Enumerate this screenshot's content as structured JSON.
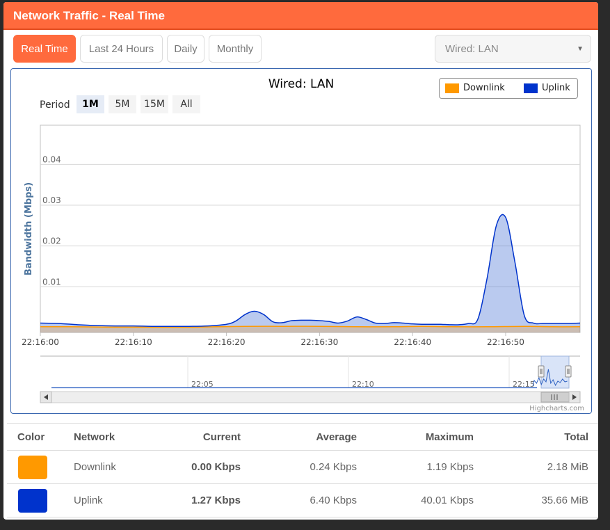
{
  "panel": {
    "title": "Network Traffic - Real Time"
  },
  "tabs": [
    {
      "label": "Real Time",
      "active": true
    },
    {
      "label": "Last 24 Hours",
      "active": false
    },
    {
      "label": "Daily",
      "active": false
    },
    {
      "label": "Monthly",
      "active": false
    }
  ],
  "network_select": {
    "value": "Wired: LAN"
  },
  "chart": {
    "title": "Wired: LAN",
    "period_label": "Period",
    "range_buttons": [
      {
        "label": "1M",
        "active": true
      },
      {
        "label": "5M",
        "active": false
      },
      {
        "label": "15M",
        "active": false
      },
      {
        "label": "All",
        "active": false
      }
    ],
    "legend": [
      {
        "name": "Downlink",
        "color": "#ff9900"
      },
      {
        "name": "Uplink",
        "color": "#0033cc"
      }
    ],
    "credits": "Highcharts.com",
    "navigator_labels": [
      "22:05",
      "22:10",
      "22:15"
    ]
  },
  "chart_data": {
    "type": "area",
    "ylabel": "Bandwidth (Mbps)",
    "xlabel": "",
    "y_ticks": [
      "0.01",
      "0.02",
      "0.03",
      "0.04"
    ],
    "x_ticks": [
      "22:16:00",
      "22:16:10",
      "22:16:20",
      "22:16:30",
      "22:16:40",
      "22:16:50"
    ],
    "ylim": [
      -0.0012,
      0.0496
    ],
    "xlim_seconds": [
      0,
      58
    ],
    "x_unit": "seconds after 22:16:00",
    "grid": true,
    "legend_position": "top-right",
    "series": [
      {
        "name": "Downlink",
        "color": "#ff9900",
        "x": [
          0,
          3,
          8,
          12,
          16,
          19,
          22,
          26,
          30,
          34,
          38,
          41,
          44,
          48,
          52,
          55,
          58
        ],
        "y": [
          0.0002,
          0.0002,
          0.0001,
          0.0001,
          0.0001,
          0.0002,
          0.0003,
          0.0003,
          0.0003,
          0.0002,
          0.0002,
          0.0003,
          0.0002,
          0.0002,
          0.0003,
          0.0002,
          0.0002
        ]
      },
      {
        "name": "Uplink",
        "color": "#0033cc",
        "x": [
          0,
          2,
          4,
          6,
          8,
          10,
          12,
          14,
          16,
          18,
          20,
          21,
          22,
          23,
          24,
          25,
          26,
          27,
          28,
          29,
          30,
          31,
          32,
          33,
          34,
          35,
          36,
          37,
          38,
          39,
          40,
          41,
          42,
          43,
          44,
          45,
          46,
          47,
          48,
          49,
          50,
          51,
          52,
          53,
          54,
          55,
          56,
          57,
          58
        ],
        "y": [
          0.0011,
          0.001,
          0.0007,
          0.0005,
          0.0004,
          0.0004,
          0.0003,
          0.0003,
          0.0003,
          0.0004,
          0.0008,
          0.0016,
          0.0032,
          0.004,
          0.0032,
          0.0014,
          0.0012,
          0.0017,
          0.0018,
          0.0018,
          0.0017,
          0.0015,
          0.0011,
          0.0016,
          0.0026,
          0.002,
          0.0011,
          0.001,
          0.0012,
          0.0011,
          0.0009,
          0.0008,
          0.0008,
          0.0008,
          0.0007,
          0.0007,
          0.001,
          0.002,
          0.012,
          0.025,
          0.027,
          0.016,
          0.003,
          0.0011,
          0.001,
          0.001,
          0.001,
          0.001,
          0.0011
        ]
      }
    ]
  },
  "table": {
    "headers": [
      "Color",
      "Network",
      "Current",
      "Average",
      "Maximum",
      "Total"
    ],
    "rows": [
      {
        "color": "#ff9900",
        "network": "Downlink",
        "current": "0.00 Kbps",
        "average": "0.24 Kbps",
        "maximum": "1.19 Kbps",
        "total": "2.18 MiB"
      },
      {
        "color": "#0033cc",
        "network": "Uplink",
        "current": "1.27 Kbps",
        "average": "6.40 Kbps",
        "maximum": "40.01 Kbps",
        "total": "35.66 MiB"
      }
    ]
  }
}
